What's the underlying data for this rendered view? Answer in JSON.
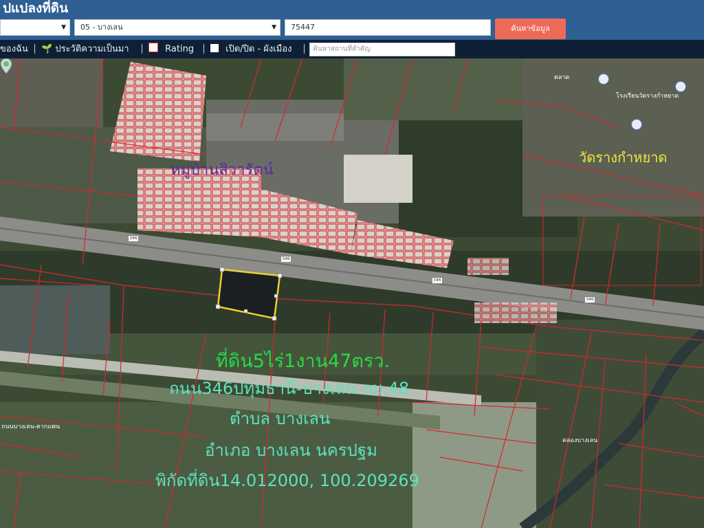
{
  "header": {
    "title": "ปแปลงที่ดิน",
    "province_select": "",
    "district_select": "05 - บางเลน",
    "parcel_number": "75447",
    "search_button": "ค้นหาข้อมูล"
  },
  "toolbar": {
    "item_1": "ของฉัน",
    "item_2": "ประวัติความเป็นมา",
    "item_3": "Rating",
    "item_4": "เปิด/ปิด - ผังเมือง",
    "place_search_placeholder": "ค้นหาสถานที่สำคัญ"
  },
  "map": {
    "village_label": "หมู่บ้านสิวารัตน์",
    "temple_label": "วัดรางกำหยาด",
    "road_label_small": "ถนนบางเลน-ตากแพน",
    "poi_1": "โรงเรียนวัดรางกำหยาด",
    "poi_2": "ตลาด",
    "poi_3": "คลองบางเลน",
    "road_sign": "346",
    "overlay": {
      "line_1": "ที่ดิน5ไร่1งาน47ตรว.",
      "line_2": "ถนน346ปทุมธานี-บางเลน กม.48",
      "line_3": "ตำบล บางเลน",
      "line_4": "อำเภอ บางเลน นครปฐม",
      "line_5": "พิกัดที่ดิน14.012000, 100.209269"
    }
  },
  "colors": {
    "header": "#2f5f93",
    "toolbar": "#0f2036",
    "search_button": "#ee6a58",
    "parcel_lines": "#d9252a",
    "highlight_border": "#f1d02c"
  }
}
